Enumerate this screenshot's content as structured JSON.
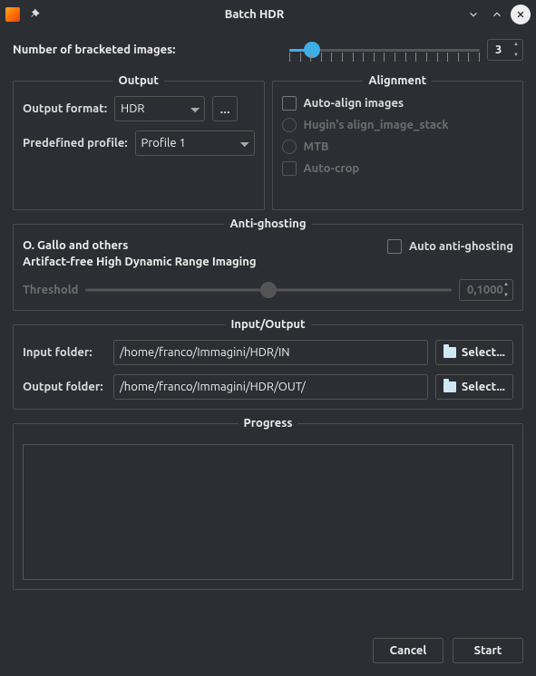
{
  "title": "Batch HDR",
  "bracket": {
    "label": "Number of bracketed images:",
    "value": "3",
    "min": 2,
    "max": 20,
    "pos_pct": 12,
    "ticks": 19
  },
  "output": {
    "legend": "Output",
    "format_label": "Output format:",
    "format_value": "HDR",
    "more_label": "...",
    "profile_label": "Predefined profile:",
    "profile_value": "Profile 1"
  },
  "alignment": {
    "legend": "Alignment",
    "auto_align": "Auto-align images",
    "hugin": "Hugin's align_image_stack",
    "mtb": "MTB",
    "auto_crop": "Auto-crop"
  },
  "ghost": {
    "legend": "Anti-ghosting",
    "note1": "O. Gallo and others",
    "note2": "Artifact-free High Dynamic Range Imaging",
    "auto_label": "Auto anti-ghosting",
    "threshold_label": "Threshold",
    "threshold_value": "0,1000",
    "threshold_pos_pct": 50
  },
  "io": {
    "legend": "Input/Output",
    "input_label": "Input folder:",
    "input_value": "/home/franco/Immagini/HDR/IN",
    "output_label": "Output folder:",
    "output_value": "/home/franco/Immagini/HDR/OUT/",
    "select": "Select..."
  },
  "progress": {
    "legend": "Progress"
  },
  "buttons": {
    "cancel": "Cancel",
    "start": "Start"
  }
}
